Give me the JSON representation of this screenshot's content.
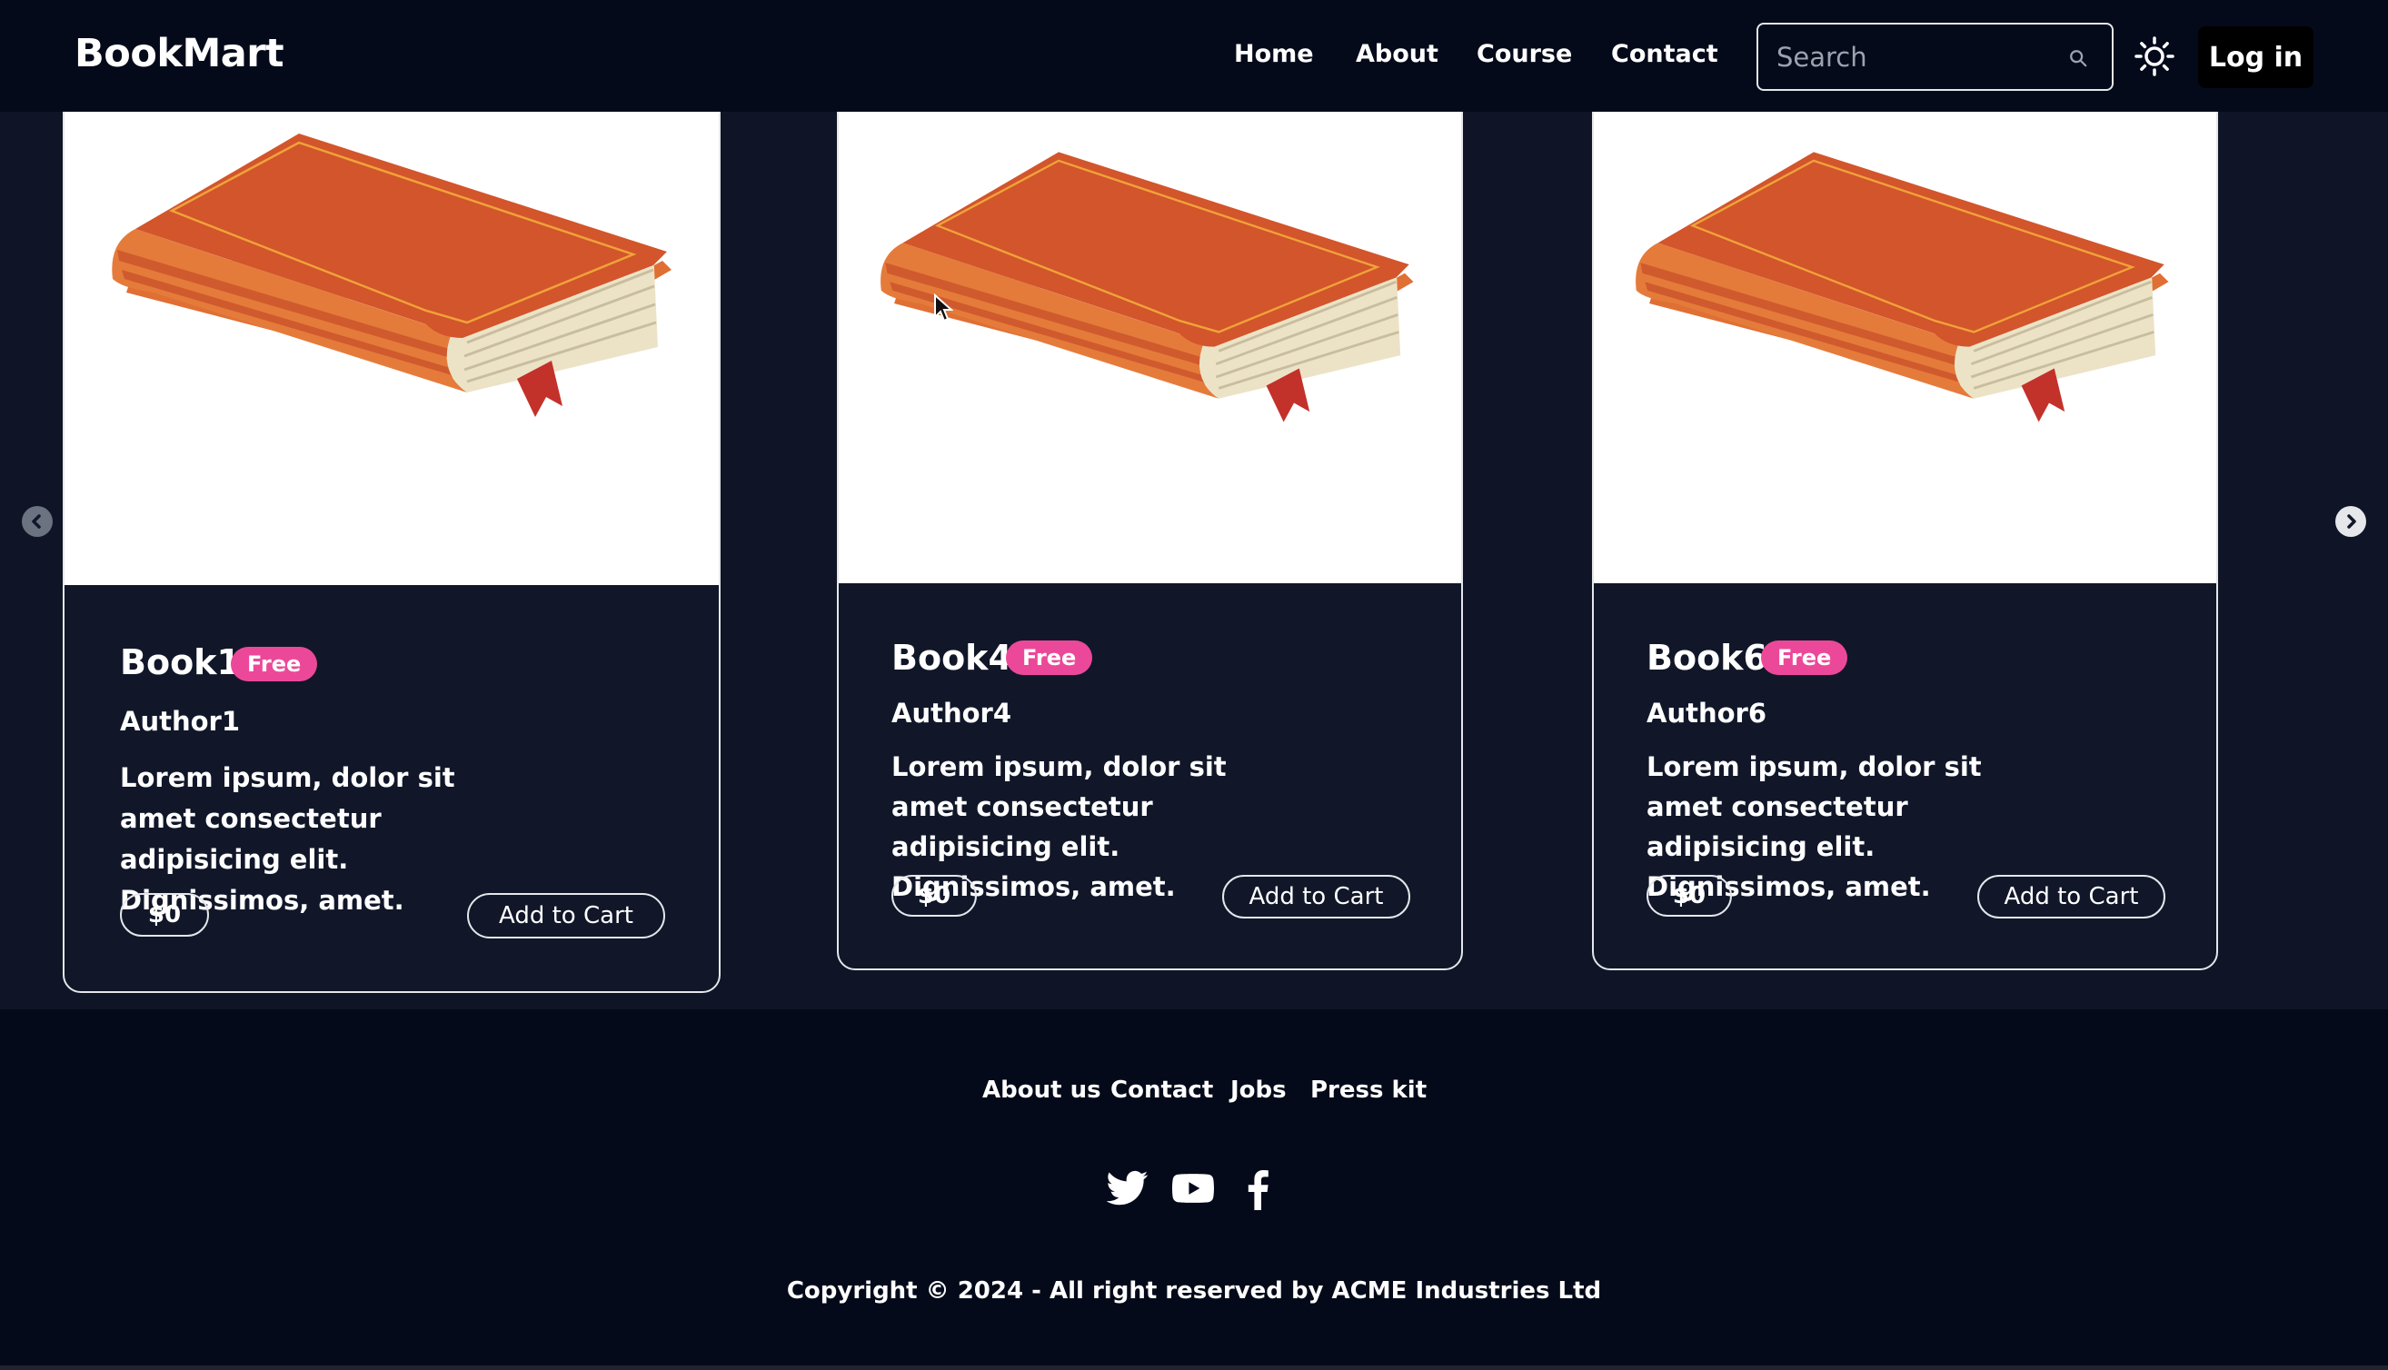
{
  "app": {
    "brand": "BookMart"
  },
  "nav": {
    "links": [
      "Home",
      "About",
      "Course",
      "Contact"
    ],
    "search_placeholder": "Search",
    "theme_icon": "sun-icon",
    "login_label": "Log in"
  },
  "carousel": {
    "prev_icon": "chevron-left-icon",
    "next_icon": "chevron-right-icon",
    "cards": [
      {
        "title": "Book1",
        "badge": "Free",
        "author": "Author1",
        "description": "Lorem ipsum, dolor sit amet consectetur adipisicing elit. Dignissimos, amet.",
        "price": "$0",
        "cta": "Add to Cart",
        "image_icon": "book-illustration"
      },
      {
        "title": "Book4",
        "badge": "Free",
        "author": "Author4",
        "description": "Lorem ipsum, dolor sit amet consectetur adipisicing elit. Dignissimos, amet.",
        "price": "$0",
        "cta": "Add to Cart",
        "image_icon": "book-illustration"
      },
      {
        "title": "Book6",
        "badge": "Free",
        "author": "Author6",
        "description": "Lorem ipsum, dolor sit amet consectetur adipisicing elit. Dignissimos, amet.",
        "price": "$0",
        "cta": "Add to Cart",
        "image_icon": "book-illustration"
      }
    ]
  },
  "footer": {
    "links": [
      "About us",
      "Contact",
      "Jobs",
      "Press kit"
    ],
    "social_icons": [
      "twitter-icon",
      "youtube-icon",
      "facebook-icon"
    ],
    "copyright": "Copyright © 2024 - All right reserved by ACME Industries Ltd"
  },
  "colors": {
    "background": "#0f1526",
    "navbar": "#050a1a",
    "badge": "#ec4899",
    "book_cover": "#d2552b"
  }
}
